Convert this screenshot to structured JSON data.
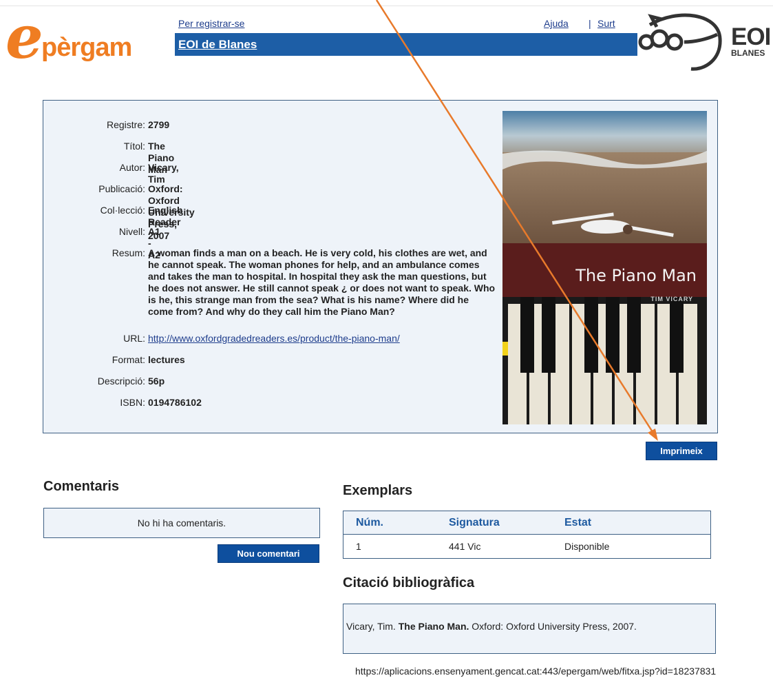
{
  "header": {
    "logo_initial": "e",
    "logo_rest": "pèrgam",
    "register_link": "Per registrar-se",
    "help_link": "Ajuda",
    "separator": "|",
    "exit_link": "Surt",
    "school": "EOI de Blanes",
    "school_logo_big": "EOI",
    "school_logo_small": "BLANES"
  },
  "record": {
    "fields": [
      {
        "label": "Registre:",
        "value": "2799"
      },
      {
        "label": "Títol:",
        "value": "The Piano Man"
      },
      {
        "label": "Autor:",
        "value": "Vicary, Tim"
      },
      {
        "label": "Publicació:",
        "value": "Oxford: Oxford University Press, 2007"
      },
      {
        "label": "Col·lecció:",
        "value": "English Reader"
      },
      {
        "label": "Nivell:",
        "value": "A1 - A2"
      },
      {
        "label": "Resum:",
        "value": "A woman finds a man on a beach. He is very cold, his clothes are wet, and he cannot speak. The woman phones for help, and an ambulance comes and takes the man to hospital. In hospital they ask the man questions, but he does not answer. He still cannot speak ¿ or does not want to speak. Who is he, this strange man from the sea? What is his name? Where did he come from? And why do they call him the Piano Man?"
      },
      {
        "label": "URL:",
        "value": "http://www.oxfordgradedreaders.es/product/the-piano-man/"
      },
      {
        "label": "Format:",
        "value": "lectures"
      },
      {
        "label": "Descripció:",
        "value": "56p"
      },
      {
        "label": "ISBN:",
        "value": "0194786102"
      }
    ],
    "cover_title": "The Piano Man",
    "cover_author": "TIM VICARY"
  },
  "print_button": "Imprimeix",
  "comments": {
    "heading": "Comentaris",
    "empty_text": "No hi ha comentaris.",
    "new_button": "Nou comentari"
  },
  "copies": {
    "heading": "Exemplars",
    "columns": [
      "Núm.",
      "Signatura",
      "Estat"
    ],
    "rows": [
      [
        "1",
        "441 Vic",
        "Disponible"
      ]
    ]
  },
  "citation": {
    "heading": "Citació bibliogràfica",
    "author": "Vicary, Tim.",
    "title": "The Piano Man.",
    "publication": "Oxford: Oxford University Press, 2007."
  },
  "footer_url": "https://aplicacions.ensenyament.gencat.cat:443/epergam/web/fitxa.jsp?id=18237831",
  "colors": {
    "accent_orange": "#ef7d22",
    "header_blue": "#1d5ea6",
    "button_blue": "#0e4f9e",
    "panel_bg": "#eef3f9"
  }
}
